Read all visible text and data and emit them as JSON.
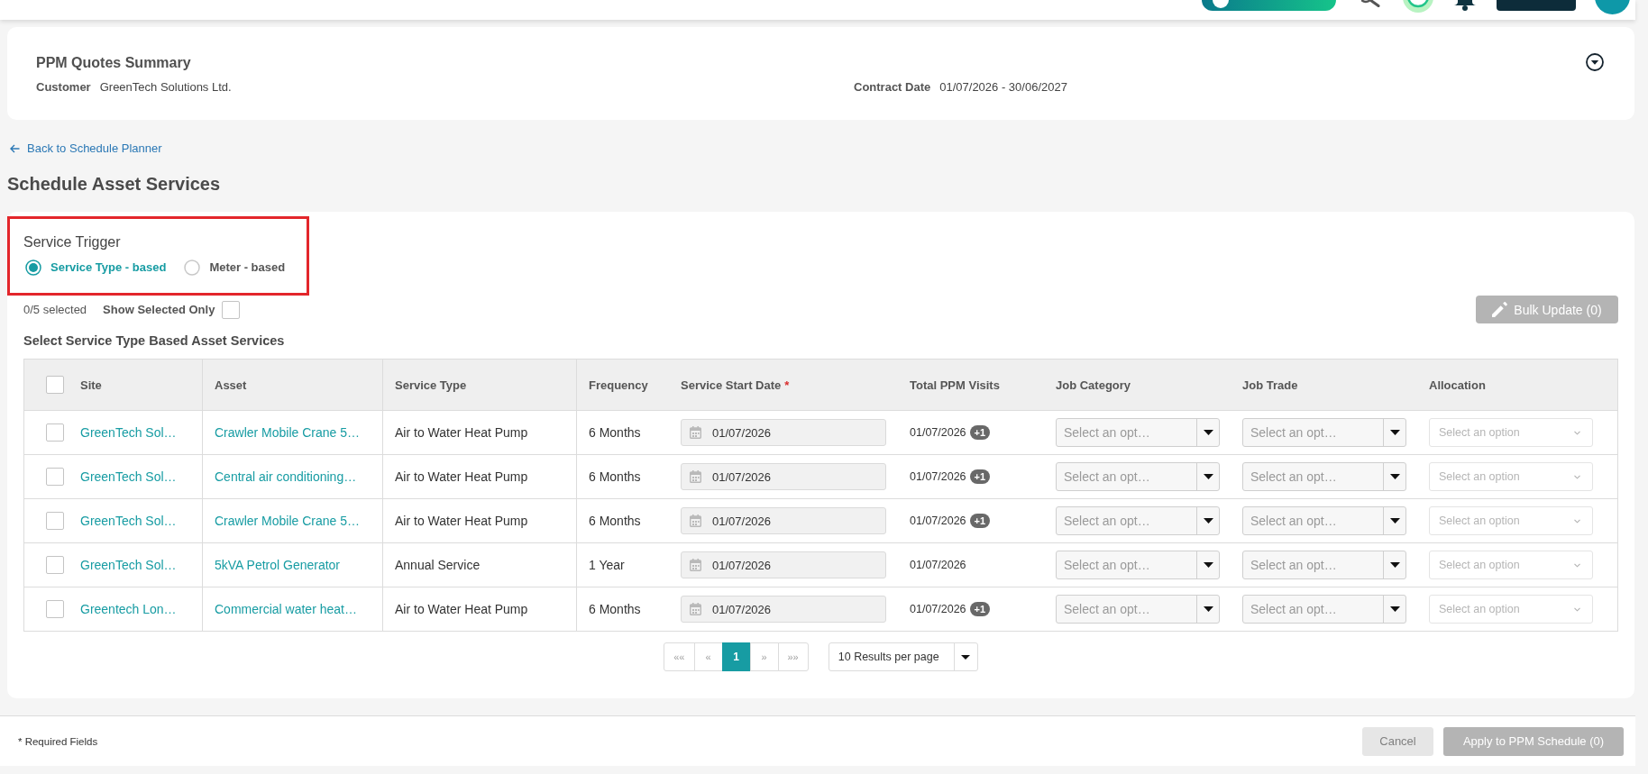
{
  "summary": {
    "title": "PPM Quotes Summary",
    "fields": [
      {
        "label": "Customer",
        "value": "GreenTech Solutions Ltd."
      },
      {
        "label": "Contract Date",
        "value": "01/07/2026 - 30/06/2027"
      }
    ]
  },
  "back_link": {
    "label": "Back to Schedule Planner"
  },
  "page_title": "Schedule Asset Services",
  "service_trigger": {
    "title": "Service Trigger",
    "highlighted": true,
    "options": [
      {
        "label": "Service Type - based",
        "selected": true
      },
      {
        "label": "Meter - based",
        "selected": false
      }
    ]
  },
  "selection": {
    "count": "0/5 selected",
    "show_selected_only": {
      "label": "Show Selected Only",
      "checked": false
    }
  },
  "bulk_update": {
    "label": "Bulk Update (0)",
    "disabled": true
  },
  "table": {
    "title": "Select Service Type Based Asset Services",
    "select_all": {
      "checked": false
    },
    "columns": [
      {
        "label": "Site"
      },
      {
        "label": "Asset"
      },
      {
        "label": "Service Type"
      },
      {
        "label": "Frequency"
      },
      {
        "label": "Service Start Date",
        "required_mark": "*"
      },
      {
        "label": "Total PPM Visits"
      },
      {
        "label": "Job Category"
      },
      {
        "label": "Job Trade"
      },
      {
        "label": "Allocation"
      }
    ],
    "rows": [
      {
        "checked": false,
        "site": "GreenTech Sol…",
        "asset": "Crawler Mobile Crane 5…",
        "service_type": "Air to Water Heat Pump",
        "frequency": "6 Months",
        "start_date": {
          "value": "01/07/2026"
        },
        "visits": {
          "date": "01/07/2026",
          "extra": "+1"
        },
        "job_category": {
          "placeholder": "Select an opt…",
          "disabled": false
        },
        "job_trade": {
          "placeholder": "Select an opt…",
          "disabled": false
        },
        "allocation": {
          "placeholder": "Select an option",
          "disabled": true
        }
      },
      {
        "checked": false,
        "site": "GreenTech Sol…",
        "asset": "Central air conditioning…",
        "service_type": "Air to Water Heat Pump",
        "frequency": "6 Months",
        "start_date": {
          "value": "01/07/2026"
        },
        "visits": {
          "date": "01/07/2026",
          "extra": "+1"
        },
        "job_category": {
          "placeholder": "Select an opt…",
          "disabled": false
        },
        "job_trade": {
          "placeholder": "Select an opt…",
          "disabled": false
        },
        "allocation": {
          "placeholder": "Select an option",
          "disabled": true
        }
      },
      {
        "checked": false,
        "site": "GreenTech Sol…",
        "asset": "Crawler Mobile Crane 5…",
        "service_type": "Air to Water Heat Pump",
        "frequency": "6 Months",
        "start_date": {
          "value": "01/07/2026"
        },
        "visits": {
          "date": "01/07/2026",
          "extra": "+1"
        },
        "job_category": {
          "placeholder": "Select an opt…",
          "disabled": false
        },
        "job_trade": {
          "placeholder": "Select an opt…",
          "disabled": false
        },
        "allocation": {
          "placeholder": "Select an option",
          "disabled": true
        }
      },
      {
        "checked": false,
        "site": "GreenTech Sol…",
        "asset": "5kVA Petrol Generator",
        "service_type": "Annual Service",
        "frequency": "1 Year",
        "start_date": {
          "value": "01/07/2026"
        },
        "visits": {
          "date": "01/07/2026"
        },
        "job_category": {
          "placeholder": "Select an opt…",
          "disabled": false
        },
        "job_trade": {
          "placeholder": "Select an opt…",
          "disabled": false
        },
        "allocation": {
          "placeholder": "Select an option",
          "disabled": true
        }
      },
      {
        "checked": false,
        "site": "Greentech Lon…",
        "asset": "Commercial water heat…",
        "service_type": "Air to Water Heat Pump",
        "frequency": "6 Months",
        "start_date": {
          "value": "01/07/2026"
        },
        "visits": {
          "date": "01/07/2026",
          "extra": "+1"
        },
        "job_category": {
          "placeholder": "Select an opt…",
          "disabled": false
        },
        "job_trade": {
          "placeholder": "Select an opt…",
          "disabled": false
        },
        "allocation": {
          "placeholder": "Select an option",
          "disabled": true
        }
      }
    ]
  },
  "pagination": {
    "nav_before": [
      {
        "label": "««",
        "disabled": true
      },
      {
        "label": "«",
        "disabled": true
      }
    ],
    "pages": [
      {
        "label": "1",
        "selected": true
      }
    ],
    "nav_after": [
      {
        "label": "»",
        "disabled": true
      },
      {
        "label": "»»",
        "disabled": true
      }
    ],
    "per_page": {
      "value": "10 Results per page"
    }
  },
  "footer": {
    "note": "* Required Fields",
    "buttons": [
      {
        "label": "Cancel",
        "kind": "secondary",
        "disabled": true
      },
      {
        "label": "Apply to PPM Schedule (0)",
        "kind": "primary",
        "disabled": true
      }
    ]
  }
}
